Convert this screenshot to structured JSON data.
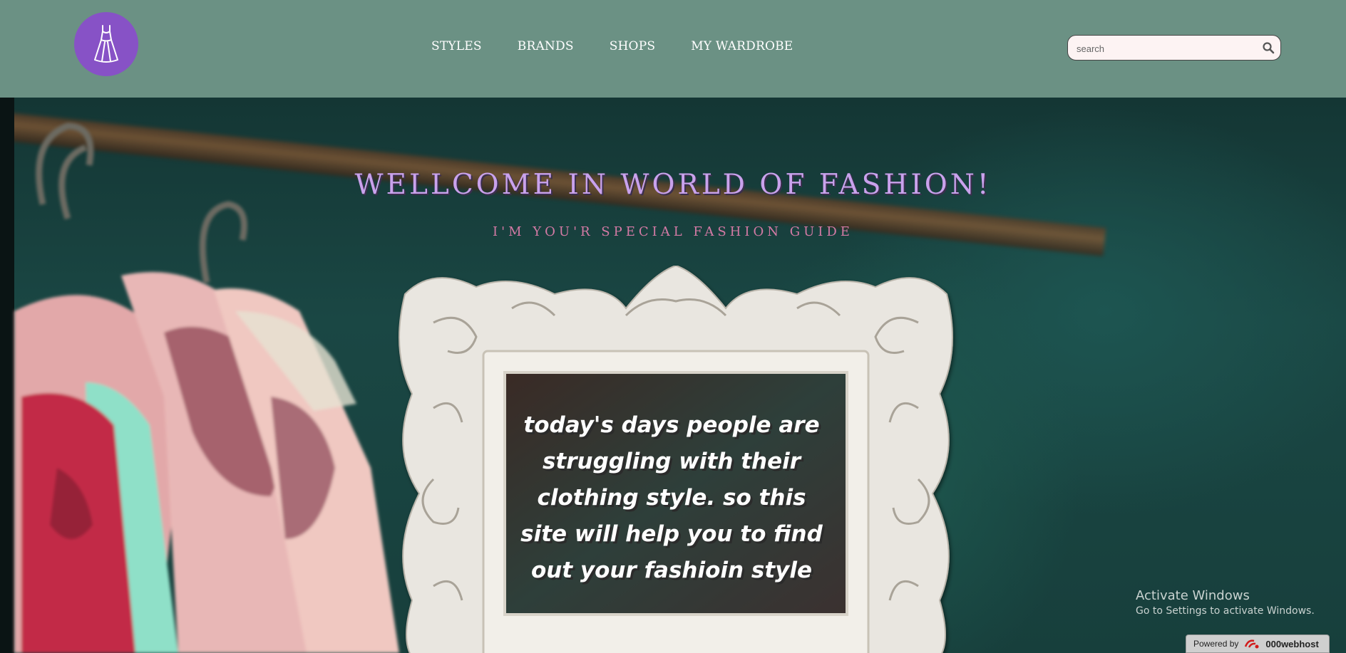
{
  "header": {
    "logo_icon": "dress-icon",
    "logo_color": "#8752c6",
    "background": "#6b9184",
    "nav": [
      "STYLES",
      "BRANDS",
      "SHOPS",
      "MY WARDROBE"
    ],
    "search": {
      "placeholder": "search",
      "value": "",
      "icon": "search-icon"
    }
  },
  "hero": {
    "title": "WELLCOME IN WORLD OF FASHION!",
    "subtitle": "I'M YOU'R SPECIAL FASHION GUIDE",
    "frame_text": "today's days people are struggling with their clothing style. so this site will help you to find out your fashioin style"
  },
  "overlay": {
    "activate_title": "Activate Windows",
    "activate_sub": "Go to Settings to activate Windows.",
    "powered_label": "Powered by",
    "powered_brand": "000webhost"
  }
}
